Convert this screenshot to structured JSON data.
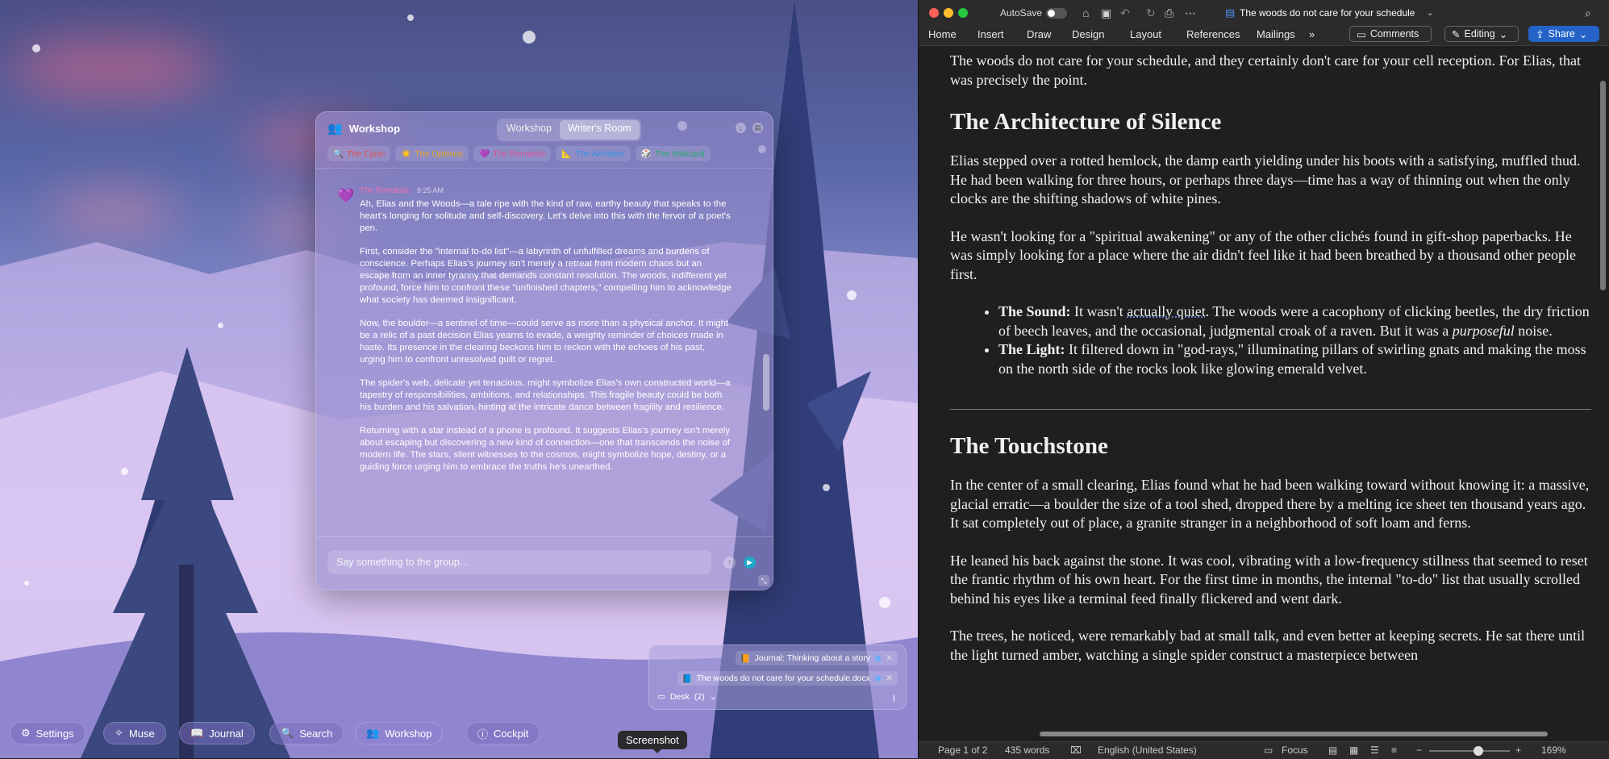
{
  "workshop": {
    "title": "Workshop",
    "tabs": [
      {
        "label": "Workshop",
        "active": false
      },
      {
        "label": "Writer's Room",
        "active": true
      }
    ],
    "personas": [
      {
        "icon": "🔍",
        "label": "The Cynic",
        "color": "#e0504a"
      },
      {
        "icon": "☀️",
        "label": "The Optimist",
        "color": "#e7a81c"
      },
      {
        "icon": "💜",
        "label": "The Romantic",
        "color": "#e0509a"
      },
      {
        "icon": "📐",
        "label": "The Architect",
        "color": "#2a96e8"
      },
      {
        "icon": "🎲",
        "label": "The Wildcard",
        "color": "#1fae68"
      }
    ],
    "message": {
      "author": "The Romantic",
      "time": "9:25 AM",
      "paragraphs": [
        "Ah, Elias and the Woods—a tale ripe with the kind of raw, earthy beauty that speaks to the heart's longing for solitude and self-discovery. Let's delve into this with the fervor of a poet's pen.",
        "First, consider the \"internal to-do list\"—a labyrinth of unfulfilled dreams and burdens of conscience. Perhaps Elias's journey isn't merely a retreat from modern chaos but an escape from an inner tyranny that demands constant resolution. The woods, indifferent yet profound, force him to confront these \"unfinished chapters,\" compelling him to acknowledge what society has deemed insignificant.",
        "Now, the boulder—a sentinel of time—could serve as more than a physical anchor. It might be a relic of a past decision Elias yearns to evade, a weighty reminder of choices made in haste. Its presence in the clearing beckons him to reckon with the echoes of his past, urging him to confront unresolved guilt or regret.",
        "The spider's web, delicate yet tenacious, might symbolize Elias's own constructed world—a tapestry of responsibilities, ambitions, and relationships. This fragile beauty could be both his burden and his salvation, hinting at the intricate dance between fragility and resilience.",
        "Returning with a star instead of a phone is profound. It suggests Elias's journey isn't merely about escaping but discovering a new kind of connection—one that transcends the noise of modern life. The stars, silent witnesses to the cosmos, might symbolize hope, destiny, or a guiding force urging him to embrace the truths he's unearthed."
      ]
    },
    "input_placeholder": "Say something to the group..."
  },
  "desk": {
    "items": [
      {
        "icon": "📙",
        "label": "Journal: Thinking about a story"
      },
      {
        "icon": "📘",
        "label": "The woods do not care for your schedule.docx"
      }
    ],
    "footer_label": "Desk",
    "footer_count": "(2)"
  },
  "dock": [
    {
      "icon": "⚙",
      "label": "Settings"
    },
    {
      "icon": "✧",
      "label": "Muse"
    },
    {
      "icon": "📖",
      "label": "Journal"
    },
    {
      "icon": "🔍",
      "label": "Search"
    },
    {
      "icon": "👥",
      "label": "Workshop"
    },
    {
      "icon": "ⓘ",
      "label": "Cockpit"
    }
  ],
  "tooltip": "Screenshot",
  "word": {
    "autosave_label": "AutoSave",
    "doc_title": "The woods do not care for your schedule",
    "ribbon_tabs": [
      "Home",
      "Insert",
      "Draw",
      "Design",
      "Layout",
      "References",
      "Mailings"
    ],
    "more_tabs": "»",
    "comments_label": "Comments",
    "editing_label": "Editing",
    "share_label": "Share",
    "doc": {
      "intro": "The woods do not care for your schedule, and they certainly don't care for your cell reception. For Elias, that was precisely the point.",
      "h1_a": "The Architecture of Silence",
      "p1": "Elias stepped over a rotted hemlock, the damp earth yielding under his boots with a satisfying, muffled thud. He had been walking for three hours, or perhaps three days—time has a way of thinning out when the only clocks are the shifting shadows of white pines.",
      "p2": "He wasn't looking for a \"spiritual awakening\" or any of the other clichés found in gift-shop paperbacks. He was simply looking for a place where the air didn't feel like it had been breathed by a thousand other people first.",
      "b1_label": "The Sound:",
      "b1_pre": " It wasn't ",
      "b1_underlined": "actually quiet",
      "b1_post": ". The woods were a cacophony of clicking beetles, the dry friction of beech leaves, and the occasional, judgmental croak of a raven. But it was a ",
      "b1_italic": "purposeful",
      "b1_end": " noise.",
      "b2_label": "The Light:",
      "b2_text": " It filtered down in \"god-rays,\" illuminating pillars of swirling gnats and making the moss on the north side of the rocks look like glowing emerald velvet.",
      "h1_b": "The Touchstone",
      "p3": "In the center of a small clearing, Elias found what he had been walking toward without knowing it: a massive, glacial erratic—a boulder the size of a tool shed, dropped there by a melting ice sheet ten thousand years ago. It sat completely out of place, a granite stranger in a neighborhood of soft loam and ferns.",
      "p4": "He leaned his back against the stone. It was cool, vibrating with a low-frequency stillness that seemed to reset the frantic rhythm of his own heart. For the first time in months, the internal \"to-do\" list that usually scrolled behind his eyes like a terminal feed finally flickered and went dark.",
      "p5": "The trees, he noticed, were remarkably bad at small talk, and even better at keeping secrets. He sat there until the light turned amber, watching a single spider construct a masterpiece between"
    },
    "status": {
      "page": "Page 1 of 2",
      "words": "435 words",
      "language": "English (United States)",
      "focus": "Focus",
      "zoom": "169%"
    }
  }
}
